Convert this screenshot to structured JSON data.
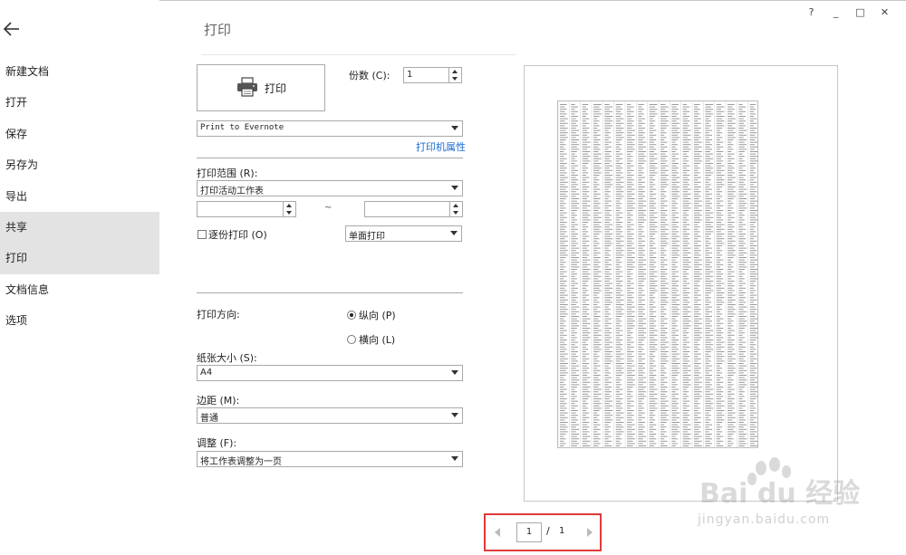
{
  "window": {
    "controls": [
      "?",
      "_",
      "□",
      "✕"
    ]
  },
  "sidebar": {
    "items": [
      {
        "label": "新建文档",
        "highlighted": false
      },
      {
        "label": "打开",
        "highlighted": false
      },
      {
        "label": "保存",
        "highlighted": false
      },
      {
        "label": "另存为",
        "highlighted": false
      },
      {
        "label": "导出",
        "highlighted": false
      },
      {
        "label": "共享",
        "highlighted": true
      },
      {
        "label": "打印",
        "highlighted": true
      },
      {
        "label": "文档信息",
        "highlighted": false
      },
      {
        "label": "选项",
        "highlighted": false
      }
    ]
  },
  "page": {
    "title": "打印"
  },
  "print": {
    "button_label": "打印",
    "copies_label": "份数 (C):",
    "copies_value": "1",
    "printer": "Print to Evernote",
    "printer_props": "打印机属性",
    "range_label": "打印范围 (R):",
    "range_value": "打印活动工作表",
    "from_value": "",
    "to_value": "",
    "tilde": "~",
    "collate_label": "逐份打印 (O)",
    "duplex_value": "单面打印",
    "orientation_label": "打印方向:",
    "portrait_label": "纵向 (P)",
    "landscape_label": "横向 (L)",
    "paper_label": "纸张大小 (S):",
    "paper_value": "A4",
    "margin_label": "边距 (M):",
    "margin_value": "普通",
    "scale_label": "调整 (F):",
    "scale_value": "将工作表调整为一页"
  },
  "pager": {
    "current": "1",
    "separator": "/",
    "total": "1"
  },
  "watermark": {
    "brand": "Bai du 经验",
    "url": "jingyan.baidu.com"
  },
  "colors": {
    "highlight": "#e3e3e3",
    "link": "#1a6bd0",
    "pager_border": "#e03a3a"
  }
}
